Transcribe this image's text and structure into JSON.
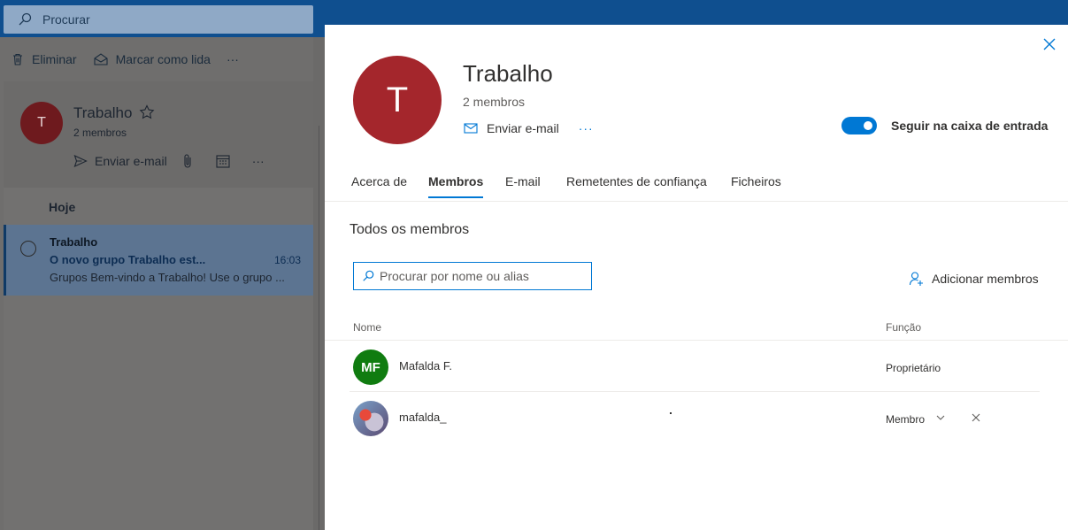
{
  "search": {
    "placeholder": "Procurar"
  },
  "commands": {
    "delete": "Eliminar",
    "mark_read": "Marcar como lida",
    "more": "···"
  },
  "group": {
    "initial": "T",
    "name": "Trabalho",
    "members": "2 membros",
    "send_email": "Enviar e-mail",
    "more": "···"
  },
  "list": {
    "section": "Hoje",
    "item": {
      "from": "Trabalho",
      "subject": "O novo grupo Trabalho est...",
      "time": "16:03",
      "preview": "Grupos Bem-vindo a Trabalho! Use o grupo ..."
    }
  },
  "panel": {
    "initial": "T",
    "title": "Trabalho",
    "members": "2 membros",
    "send_email": "Enviar e-mail",
    "more": "···",
    "follow_label": "Seguir na caixa de entrada",
    "follow_on": true,
    "tabs": [
      "Acerca de",
      "Membros",
      "E-mail",
      "Remetentes de confiança",
      "Ficheiros"
    ],
    "active_tab": "Membros",
    "section_title": "Todos os membros",
    "member_search_placeholder": "Procurar por nome ou alias",
    "add_members": "Adicionar membros",
    "columns": {
      "name": "Nome",
      "role": "Função"
    },
    "rows": [
      {
        "initials": "MF",
        "name": "Mafalda F.",
        "role": "Proprietário"
      },
      {
        "initials": "",
        "name": "mafalda_",
        "role": "Membro"
      }
    ]
  },
  "colors": {
    "accent": "#0078d4",
    "group_avatar": "#a4262c",
    "member_avatar": "#107c10"
  }
}
